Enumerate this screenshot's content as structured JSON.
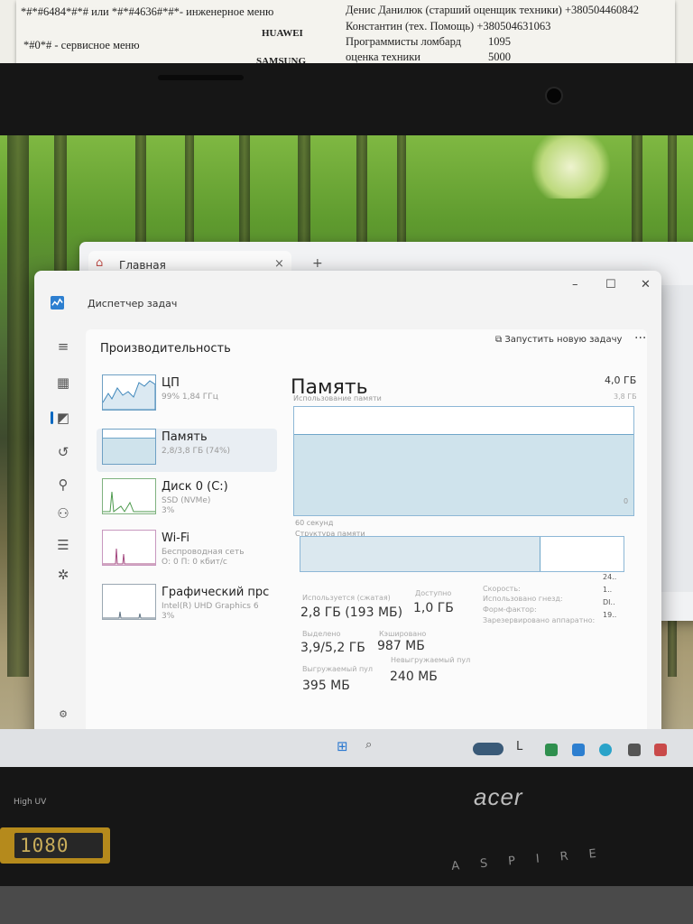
{
  "note": {
    "left_line1": "*#*#6484*#*# или *#*#4636#*#*- инженерное меню",
    "left_brand1": "HUAWEI",
    "left_line2": "*#0*# - сервисное меню",
    "left_brand2": "SAMSUNG",
    "right_line1": "Денис Данилюк (старший оценщик техники) +380504460842",
    "right_line2": "Константин (тех. Помощь) +380504631063",
    "right_line3": "Программисты ломбард",
    "right_line3_val": "1095",
    "right_line4": "оценка техники",
    "right_line4_val": "5000"
  },
  "browser": {
    "tab_label": "Главная",
    "tab_close": "×",
    "new_tab": "+"
  },
  "taskmanager": {
    "title": "Диспетчер задач",
    "section_title": "Производительность",
    "run_new_task": "Запустить новую задачу",
    "more": "···",
    "controls": {
      "min": "–",
      "max": "☐",
      "close": "✕"
    },
    "resources": [
      {
        "name": "ЦП",
        "sub": "99% 1,84 ГГц"
      },
      {
        "name": "Память",
        "sub": "2,8/3,8 ГБ (74%)"
      },
      {
        "name": "Диск 0 (C:)",
        "sub": "SSD (NVMe)",
        "sub2": "3%"
      },
      {
        "name": "Wi-Fi",
        "sub": "Беспроводная сеть",
        "sub2": "О: 0 П: 0 кбит/с"
      },
      {
        "name": "Графический прс",
        "sub": "Intel(R) UHD Graphics 6",
        "sub2": "3%"
      }
    ],
    "memory": {
      "title": "Память",
      "capacity": "4,0 ГБ",
      "capacity_sub": "3,8 ГБ",
      "usage_label": "Использование памяти",
      "time_label": "60 секунд",
      "zero_label": "0",
      "composition_label": "Структура памяти",
      "usage_fraction": 0.74,
      "stats": [
        {
          "label": "Используется (сжатая)",
          "value": "2,8 ГБ (193 МБ)"
        },
        {
          "label": "Доступно",
          "value": "1,0 ГБ"
        },
        {
          "label": "Выделено",
          "value": "3,9/5,2 ГБ"
        },
        {
          "label": "Кэшировано",
          "value": "987 МБ"
        },
        {
          "label": "Выгружаемый пул",
          "value": "395 МБ"
        },
        {
          "label": "Невыгружаемый пул",
          "value": "240 МБ"
        }
      ],
      "side": [
        {
          "label": "Скорость:",
          "value": "24.."
        },
        {
          "label": "Использовано гнезд:",
          "value": "1.."
        },
        {
          "label": "Форм-фактор:",
          "value": "DI.."
        },
        {
          "label": "Зарезервировано аппаратно:",
          "value": "19.."
        }
      ]
    }
  },
  "labels": {
    "hi_uv": "High UV",
    "sticker": "1080",
    "acer": "acer",
    "aspire": "ASPIRE"
  },
  "icons": [
    "home-icon",
    "task-manager-icon",
    "hamburger-icon",
    "processes-icon",
    "performance-icon",
    "history-icon",
    "startup-icon",
    "users-icon",
    "details-icon",
    "services-icon",
    "settings-icon",
    "windows-icon"
  ]
}
